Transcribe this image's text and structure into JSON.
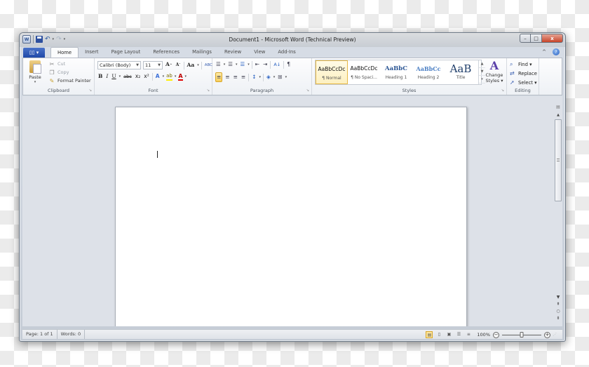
{
  "window": {
    "title": "Document1 - Microsoft Word (Technical Preview)",
    "controls": {
      "minimize": "–",
      "maximize": "□",
      "close": "x"
    }
  },
  "quick_access": {
    "app_icon": "W",
    "save_icon": "save-icon",
    "undo_glyph": "↶",
    "redo_glyph": "↷",
    "dropdown_glyph": "▾"
  },
  "file_button": {
    "label": "▯▯ ▾"
  },
  "tabs": [
    {
      "label": "Home",
      "active": true
    },
    {
      "label": "Insert"
    },
    {
      "label": "Page Layout"
    },
    {
      "label": "References"
    },
    {
      "label": "Mailings"
    },
    {
      "label": "Review"
    },
    {
      "label": "View"
    },
    {
      "label": "Add-Ins"
    }
  ],
  "tab_right": {
    "minimize_ribbon": "^",
    "help": "?"
  },
  "ribbon": {
    "clipboard": {
      "label": "Clipboard",
      "paste": "Paste",
      "paste_drop": "▾",
      "cut": "Cut",
      "copy": "Copy",
      "format_painter": "Format Painter"
    },
    "font": {
      "label": "Font",
      "font_name": "Calibri (Body)",
      "font_size": "11",
      "grow": "A",
      "shrink": "A",
      "change_case": "Aa",
      "clear_format": "ABC",
      "bold": "B",
      "italic": "I",
      "underline": "U",
      "strikethrough": "abc",
      "subscript": "x₂",
      "superscript": "x²",
      "text_effects": "A",
      "highlight": "ab",
      "font_color": "A"
    },
    "paragraph": {
      "label": "Paragraph",
      "bullets": "☰",
      "numbering": "☰",
      "multilevel": "☰",
      "decrease_indent": "⇤",
      "increase_indent": "⇥",
      "sort": "A↓",
      "show_marks": "¶",
      "align_left": "≡",
      "center": "≡",
      "align_right": "≡",
      "justify": "≡",
      "line_spacing": "↕",
      "shading": "◈",
      "borders": "⊞"
    },
    "styles": {
      "label": "Styles",
      "items": [
        {
          "sample": "AaBbCcDc",
          "name": "¶ Normal",
          "selected": true
        },
        {
          "sample": "AaBbCcDc",
          "name": "¶ No Spaci..."
        },
        {
          "sample": "AaBbC",
          "name": "Heading 1"
        },
        {
          "sample": "AaBbCc",
          "name": "Heading 2"
        },
        {
          "sample": "AaB",
          "name": "Title"
        }
      ],
      "change_styles_line1": "Change",
      "change_styles_line2": "Styles ▾"
    },
    "editing": {
      "label": "Editing",
      "find": "Find ▾",
      "replace": "Replace",
      "select": "Select ▾"
    }
  },
  "status_bar": {
    "page": "Page: 1 of 1",
    "words": "Words: 0",
    "zoom": "100%",
    "zoom_fraction": 0.5,
    "zoom_out": "−",
    "zoom_in": "+"
  },
  "colors": {
    "file_tab": "#1f49a8",
    "selection_gold": "#f6cf5c",
    "close_red": "#c8452a"
  }
}
